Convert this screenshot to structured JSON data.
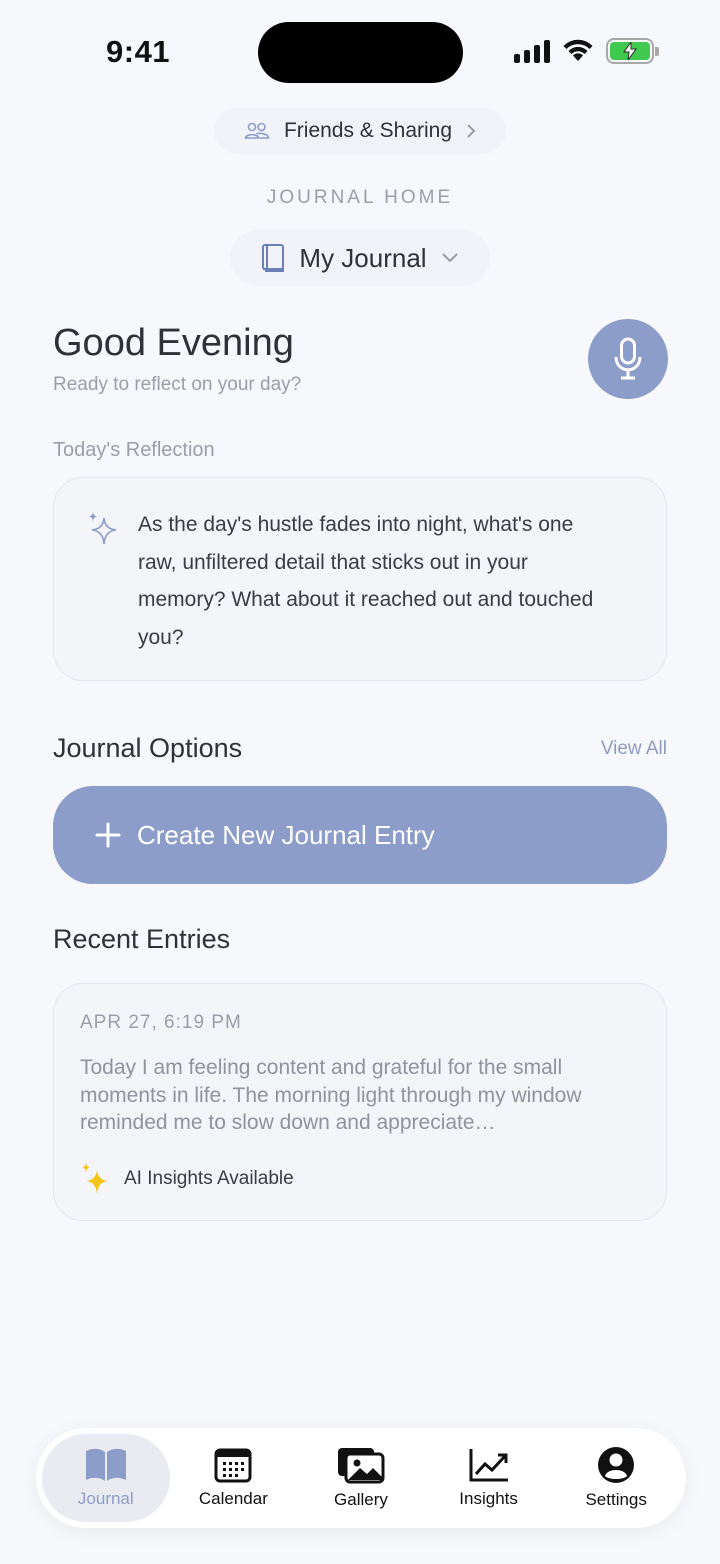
{
  "status_bar": {
    "time": "9:41",
    "battery_color": "#3fc94f"
  },
  "header": {
    "friends_label": "Friends & Sharing",
    "section_caps": "JOURNAL HOME",
    "journal_name": "My Journal"
  },
  "greeting": {
    "title": "Good Evening",
    "subtitle": "Ready to reflect on your day?"
  },
  "reflection": {
    "label": "Today's Reflection",
    "prompt": "As the day's hustle fades into night, what's one raw, unfiltered detail that sticks out in your memory? What about it reached out and touched you?"
  },
  "options": {
    "title": "Journal Options",
    "view_all": "View All",
    "create_label": "Create New Journal Entry"
  },
  "recent": {
    "title": "Recent Entries",
    "entries": [
      {
        "date": "APR 27, 6:19 PM",
        "text": "Today I am feeling content and grateful for the small moments in life. The morning light through my window reminded me to slow down and appreciate…",
        "insight_label": "AI Insights Available"
      }
    ]
  },
  "tabs": [
    {
      "label": "Journal",
      "icon": "book-icon",
      "active": true
    },
    {
      "label": "Calendar",
      "icon": "calendar-icon",
      "active": false
    },
    {
      "label": "Gallery",
      "icon": "gallery-icon",
      "active": false
    },
    {
      "label": "Insights",
      "icon": "chart-icon",
      "active": false
    },
    {
      "label": "Settings",
      "icon": "person-icon",
      "active": false
    }
  ],
  "colors": {
    "accent": "#8c9dc9",
    "background": "#f7f8fb",
    "sparkle_gold": "#f5c518"
  }
}
